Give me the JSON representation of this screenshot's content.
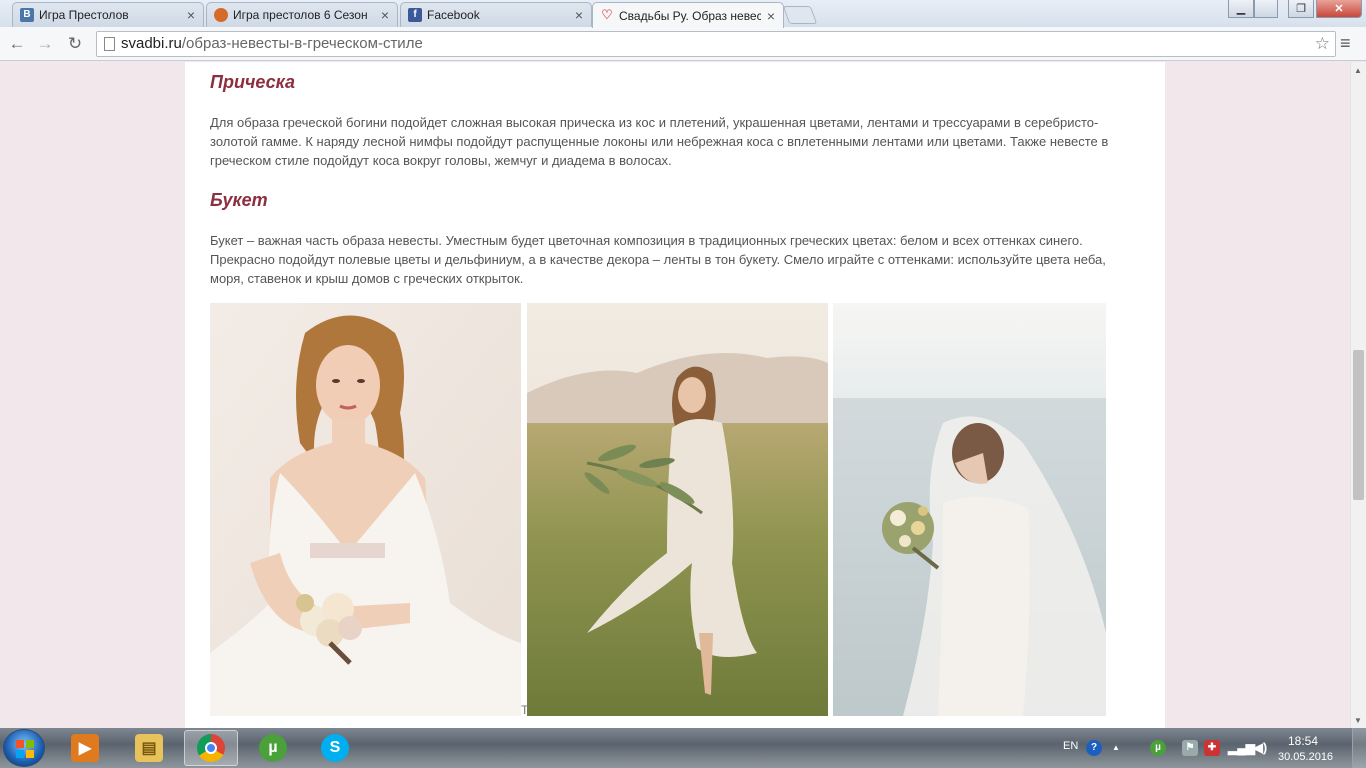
{
  "tabs": [
    {
      "title": "Игра Престолов",
      "favicon": "vk-icon",
      "favicon_letter": "В",
      "favicon_color": "#4a76a8",
      "active": false
    },
    {
      "title": "Игра престолов 6 Сезон",
      "favicon": "site-icon",
      "favicon_letter": "",
      "favicon_color": "#d46b2a",
      "active": false
    },
    {
      "title": "Facebook",
      "favicon": "facebook-icon",
      "favicon_letter": "f",
      "favicon_color": "#3b5998",
      "active": false
    },
    {
      "title": "Свадьбы Ру. Образ невес",
      "favicon": "heart-icon",
      "favicon_letter": "♡",
      "favicon_color": "#e4737f",
      "active": true
    }
  ],
  "tab_close_glyph": "×",
  "window": {
    "minimize": "▁",
    "maximize": "❐",
    "close": "✕"
  },
  "toolbar": {
    "back": "←",
    "forward": "→",
    "reload": "↻",
    "url_domain": "svadbi.ru",
    "url_path": "/образ-невесты-в-греческом-стиле",
    "star": "☆",
    "menu": "≡"
  },
  "article": {
    "heading_hair": "Прическа",
    "para_hair": "Для образа греческой богини подойдет сложная высокая прическа из кос и плетений, украшенная цветами, лентами и трессуарами в серебристо-золотой гамме. К наряду лесной нимфы подойдут распущенные локоны или небрежная коса с вплетенными лентами или цветами. Также невесте в греческом стиле подойдут коса вокруг головы, жемчуг и диадема в волосах.",
    "heading_bouquet": "Букет",
    "para_bouquet": "Букет – важная часть образа невесты. Уместным будет цветочная композиция в традиционных греческих цветах: белом и всех оттенках синего. Прекрасно подойдут полевые цветы и дельфиниум, а в качестве декора – ленты в тон букету. Смело играйте с оттенками: используйте цвета неба, моря, ставенок и крыш домов с греческих открыток.",
    "caption_fragment": "Т"
  },
  "taskbar": {
    "apps": [
      {
        "name": "media-player",
        "icon": "media-player-icon",
        "color": "#e07a1e",
        "glyph": "▶",
        "active": false
      },
      {
        "name": "file-explorer",
        "icon": "folder-icon",
        "color": "#e8c25a",
        "glyph": "▤",
        "active": false
      },
      {
        "name": "chrome",
        "icon": "chrome-icon",
        "color": "#db4437",
        "glyph": "◉",
        "active": true
      },
      {
        "name": "utorrent",
        "icon": "utorrent-icon",
        "color": "#4aa13a",
        "glyph": "µ",
        "active": false
      },
      {
        "name": "skype",
        "icon": "skype-icon",
        "color": "#00aff0",
        "glyph": "S",
        "active": false
      }
    ],
    "language": "EN",
    "help": "?",
    "clock_time": "18:54",
    "clock_date": "30.05.2016"
  }
}
